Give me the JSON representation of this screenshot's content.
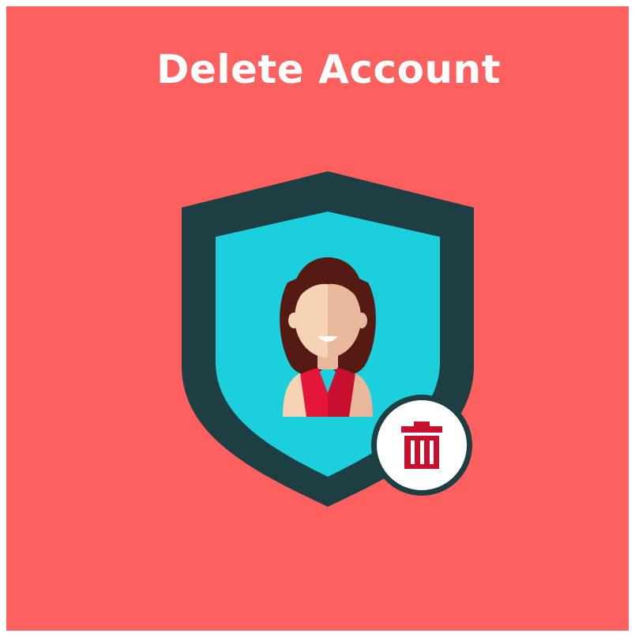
{
  "title": "Delete Account",
  "icons": {
    "shield": "shield-icon",
    "user": "user-avatar-icon",
    "delete": "trash-icon"
  },
  "colors": {
    "background": "#fe5f5f",
    "shield_outer": "#1d3e43",
    "shield_inner": "#1ccfdd",
    "hair": "#551a14",
    "skin_light": "#f7d3b5",
    "skin_shade": "#e9b79a",
    "dress": "#e5163a",
    "trash": "#c8102e",
    "badge_fill": "#ffffff"
  }
}
